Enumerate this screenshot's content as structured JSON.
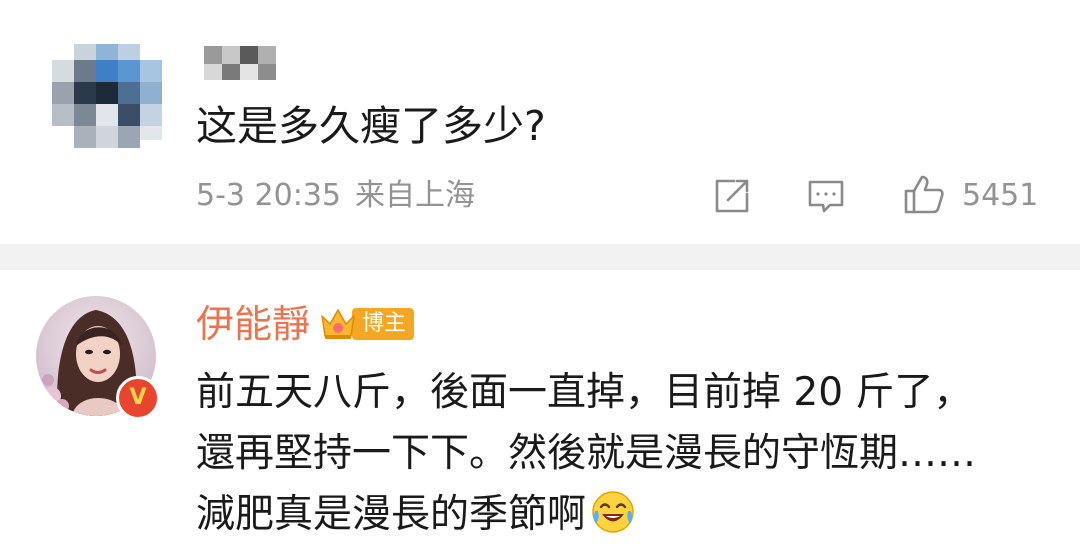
{
  "comment_1": {
    "text": "这是多久瘦了多少?",
    "time": "5-3 20:35",
    "location": "来自上海",
    "like_count": "5451",
    "icons": [
      "share-icon",
      "comment-icon",
      "like-icon"
    ]
  },
  "comment_2": {
    "username": "伊能靜",
    "badge_label": "博主",
    "verified_mark": "V",
    "lines": [
      "前五天八斤，後面一直掉，目前掉 20 斤了，",
      "還再堅持一下下。然後就是漫長的守恆期……",
      "減肥真是漫長的季節啊"
    ],
    "emoji": "laughing-tears-emoji"
  },
  "colors": {
    "username_orange": "#eb7350",
    "meta_gray": "#939393",
    "badge_orange": "#f5a623",
    "verified_red": "#e8452f",
    "divider": "#f2f2f2"
  }
}
